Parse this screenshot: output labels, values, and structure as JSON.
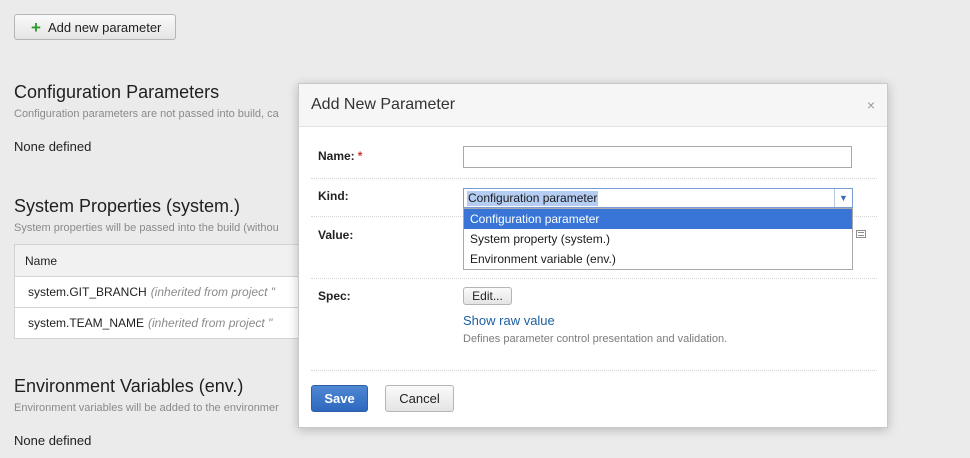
{
  "toolbar": {
    "add_label": "Add new parameter",
    "add_icon": "plus-icon"
  },
  "config": {
    "title": "Configuration Parameters",
    "desc": "Configuration parameters are not passed into build, ca",
    "none": "None defined"
  },
  "system": {
    "title": "System Properties (system.)",
    "desc": "System properties will be passed into the build (withou",
    "header": "Name",
    "rows": [
      {
        "name": "system.GIT_BRANCH",
        "note": "(inherited from project \""
      },
      {
        "name": "system.TEAM_NAME",
        "note": "(inherited from project \""
      }
    ]
  },
  "env": {
    "title": "Environment Variables (env.)",
    "desc": "Environment variables will be added to the environmer",
    "none": "None defined"
  },
  "dialog": {
    "title": "Add New Parameter",
    "close": "×",
    "name_label": "Name:",
    "required_mark": "*",
    "name_value": "",
    "kind_label": "Kind:",
    "kind_value": "Configuration parameter",
    "kind_options": [
      "Configuration parameter",
      "System property (system.)",
      "Environment variable (env.)"
    ],
    "value_label": "Value:",
    "spec_label": "Spec:",
    "edit_label": "Edit...",
    "raw_link": "Show raw value",
    "spec_desc": "Defines parameter control presentation and validation.",
    "save_label": "Save",
    "cancel_label": "Cancel"
  },
  "colors": {
    "primary": "#3875d7",
    "link": "#1d5fa3",
    "required": "#d0302a",
    "add_icon": "#2d9b2d"
  }
}
